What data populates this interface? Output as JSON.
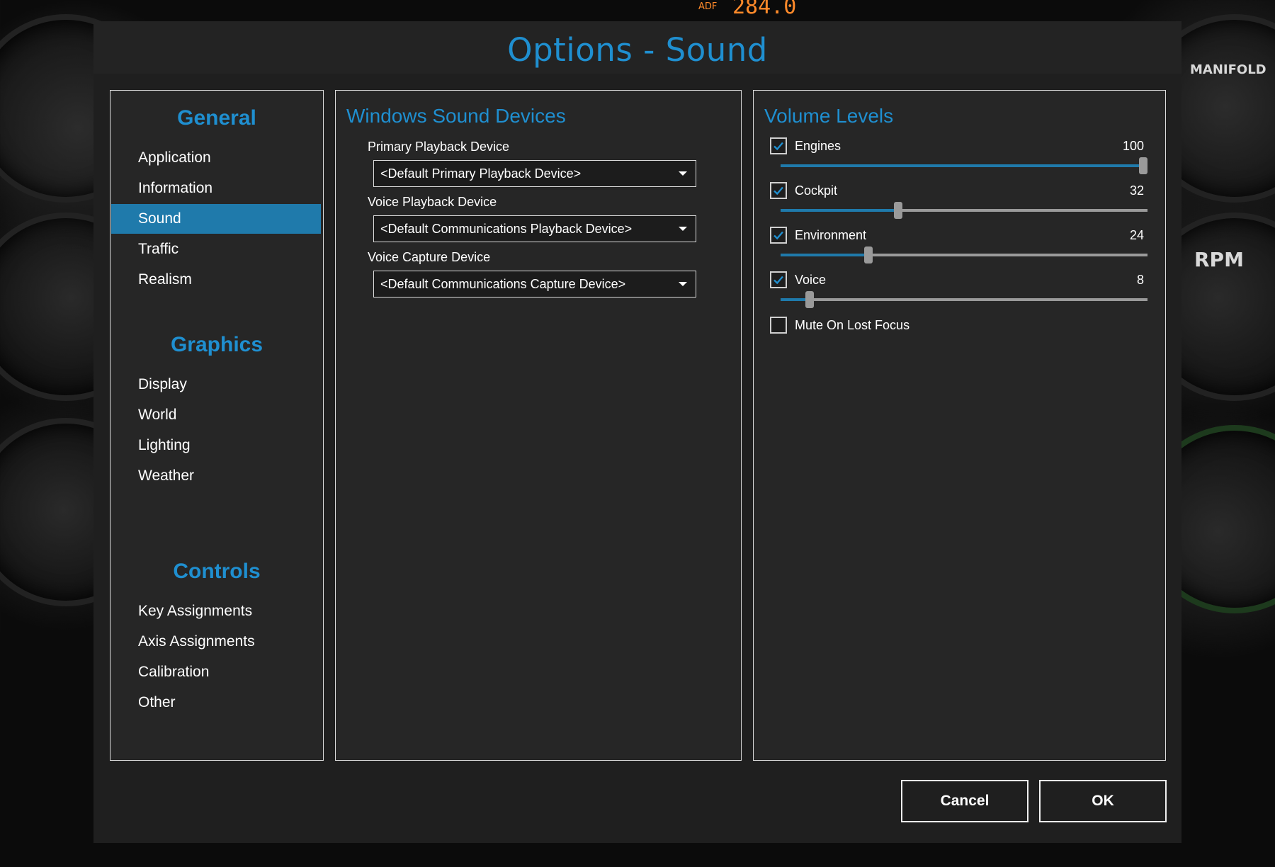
{
  "dialog": {
    "title": "Options - Sound"
  },
  "nav": {
    "groups": [
      {
        "heading": "General",
        "items": [
          "Application",
          "Information",
          "Sound",
          "Traffic",
          "Realism"
        ]
      },
      {
        "heading": "Graphics",
        "items": [
          "Display",
          "World",
          "Lighting",
          "Weather"
        ]
      },
      {
        "heading": "Controls",
        "items": [
          "Key Assignments",
          "Axis Assignments",
          "Calibration",
          "Other"
        ]
      }
    ],
    "active_item": "Sound"
  },
  "devices": {
    "title": "Windows Sound Devices",
    "fields": [
      {
        "label": "Primary Playback Device",
        "value": "<Default Primary Playback Device>"
      },
      {
        "label": "Voice Playback Device",
        "value": "<Default Communications Playback Device>"
      },
      {
        "label": "Voice Capture Device",
        "value": "<Default Communications Capture Device>"
      }
    ]
  },
  "volume": {
    "title": "Volume Levels",
    "channels": [
      {
        "label": "Engines",
        "value": "100",
        "level": 100,
        "checked": true
      },
      {
        "label": "Cockpit",
        "value": "32",
        "level": 32,
        "checked": true
      },
      {
        "label": "Environment",
        "value": "24",
        "level": 24,
        "checked": true
      },
      {
        "label": "Voice",
        "value": "8",
        "level": 8,
        "checked": true
      }
    ],
    "mute_label": "Mute On Lost Focus",
    "mute_checked": false
  },
  "buttons": {
    "cancel": "Cancel",
    "ok": "OK"
  },
  "colors": {
    "accent": "#1f8fd0",
    "active_nav": "#1f7aab",
    "check": "#1f8fd0"
  },
  "background": {
    "adf_label": "ADF",
    "adf_value": "284.0",
    "gauge_rpm": "RPM",
    "gauge_manifold": "MANIFOLD"
  }
}
